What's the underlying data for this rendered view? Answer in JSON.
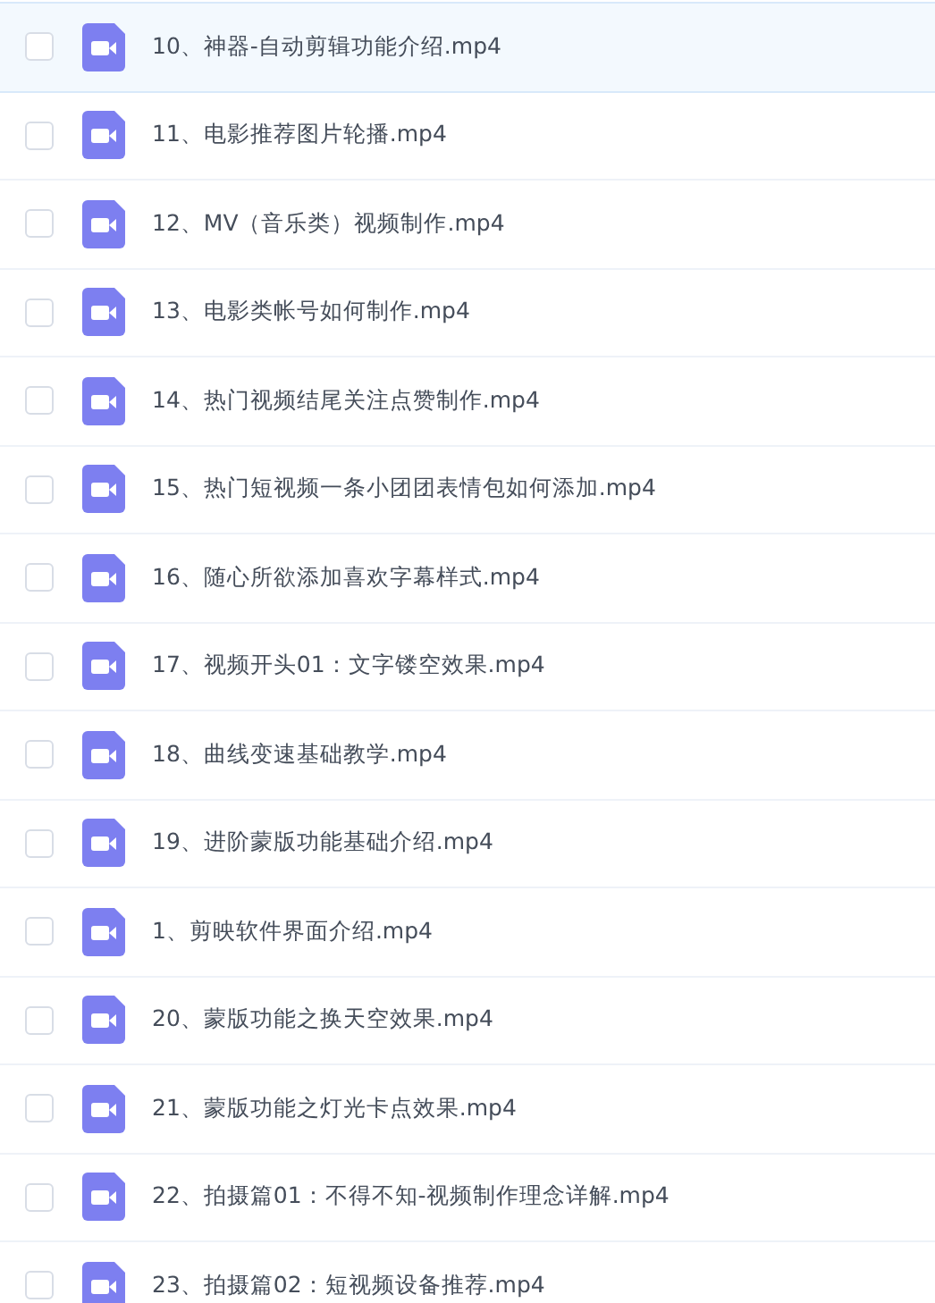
{
  "files": [
    {
      "name": "10、神器-自动剪辑功能介绍.mp4",
      "kind": "video",
      "checked": false,
      "highlighted": true
    },
    {
      "name": "11、电影推荐图片轮播.mp4",
      "kind": "video",
      "checked": false,
      "highlighted": false
    },
    {
      "name": "12、MV（音乐类）视频制作.mp4",
      "kind": "video",
      "checked": false,
      "highlighted": false
    },
    {
      "name": "13、电影类帐号如何制作.mp4",
      "kind": "video",
      "checked": false,
      "highlighted": false
    },
    {
      "name": "14、热门视频结尾关注点赞制作.mp4",
      "kind": "video",
      "checked": false,
      "highlighted": false
    },
    {
      "name": "15、热门短视频一条小团团表情包如何添加.mp4",
      "kind": "video",
      "checked": false,
      "highlighted": false
    },
    {
      "name": "16、随心所欲添加喜欢字幕样式.mp4",
      "kind": "video",
      "checked": false,
      "highlighted": false
    },
    {
      "name": "17、视频开头01：文字镂空效果.mp4",
      "kind": "video",
      "checked": false,
      "highlighted": false
    },
    {
      "name": "18、曲线变速基础教学.mp4",
      "kind": "video",
      "checked": false,
      "highlighted": false
    },
    {
      "name": "19、进阶蒙版功能基础介绍.mp4",
      "kind": "video",
      "checked": false,
      "highlighted": false
    },
    {
      "name": "1、剪映软件界面介绍.mp4",
      "kind": "video",
      "checked": false,
      "highlighted": false
    },
    {
      "name": "20、蒙版功能之换天空效果.mp4",
      "kind": "video",
      "checked": false,
      "highlighted": false
    },
    {
      "name": "21、蒙版功能之灯光卡点效果.mp4",
      "kind": "video",
      "checked": false,
      "highlighted": false
    },
    {
      "name": "22、拍摄篇01：不得不知-视频制作理念详解.mp4",
      "kind": "video",
      "checked": false,
      "highlighted": false
    },
    {
      "name": "23、拍摄篇02：短视频设备推荐.mp4",
      "kind": "video",
      "checked": false,
      "highlighted": false
    }
  ]
}
